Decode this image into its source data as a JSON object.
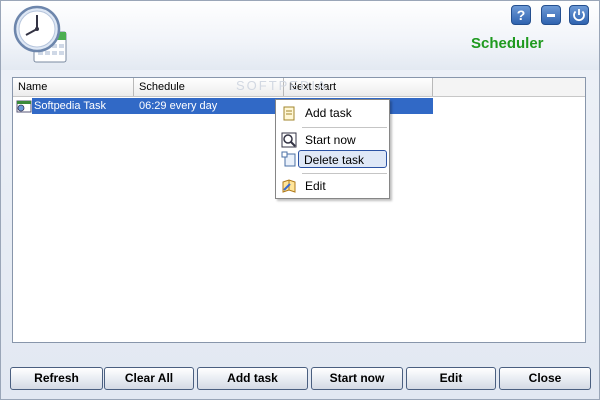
{
  "header": {
    "title": "Scheduler",
    "help_label": "?"
  },
  "watermark": "SOFTPEDIA",
  "list": {
    "columns": [
      "Name",
      "Schedule",
      "Next start"
    ],
    "rows": [
      {
        "name": "Softpedia Task",
        "schedule": "06:29 every day",
        "next_start": ""
      }
    ]
  },
  "context_menu": {
    "items": [
      "Add task",
      "Start now",
      "Delete task",
      "Edit"
    ]
  },
  "buttons": {
    "refresh": "Refresh",
    "clear_all": "Clear All",
    "add_task": "Add task",
    "start_now": "Start now",
    "edit": "Edit",
    "close": "Close"
  },
  "colors": {
    "accent": "#3169c6",
    "title": "#1f9a1f"
  }
}
